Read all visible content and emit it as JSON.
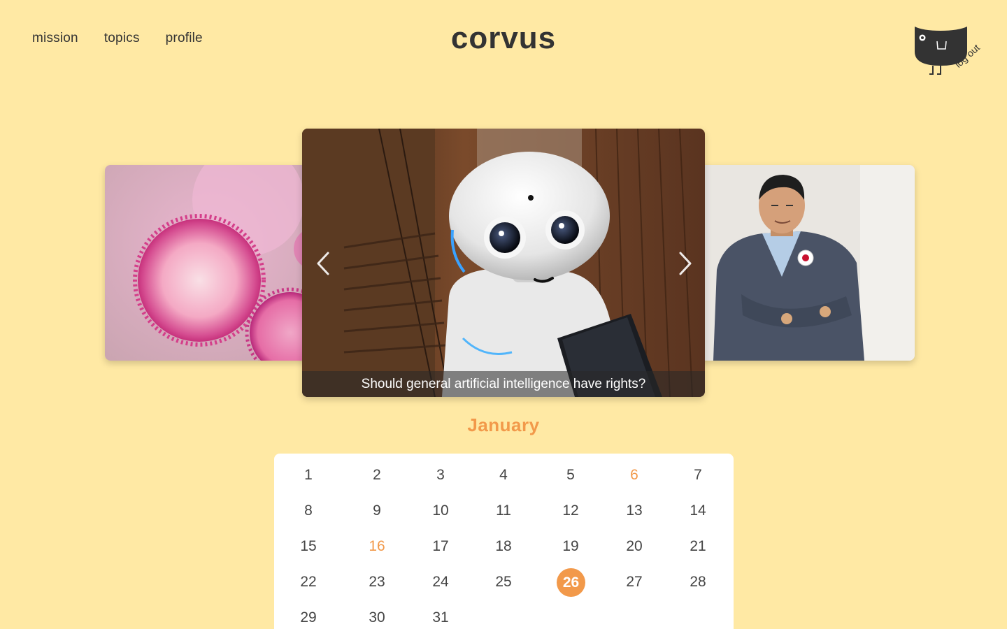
{
  "nav": {
    "items": [
      {
        "label": "mission"
      },
      {
        "label": "topics"
      },
      {
        "label": "profile"
      }
    ]
  },
  "brand": {
    "title": "corvus"
  },
  "account": {
    "logout_label": "log out",
    "mascot_icon": "crow-mascot-icon"
  },
  "carousel": {
    "slides": [
      {
        "image": "virus-microscope-photo"
      },
      {
        "image": "robot-photo",
        "caption": "Should general artificial intelligence have rights?"
      },
      {
        "image": "man-portrait-photo"
      }
    ],
    "prev_icon": "chevron-left-icon",
    "next_icon": "chevron-right-icon"
  },
  "calendar": {
    "month": "January",
    "days": [
      "1",
      "2",
      "3",
      "4",
      "5",
      "6",
      "7",
      "8",
      "9",
      "10",
      "11",
      "12",
      "13",
      "14",
      "15",
      "16",
      "17",
      "18",
      "19",
      "20",
      "21",
      "22",
      "23",
      "24",
      "25",
      "26",
      "27",
      "28",
      "29",
      "30",
      "31"
    ],
    "highlighted_days": [
      "6",
      "16"
    ],
    "selected_day": "26",
    "accent_color": "#F2994A"
  },
  "colors": {
    "background": "#FFE9A4",
    "text": "#333333"
  }
}
